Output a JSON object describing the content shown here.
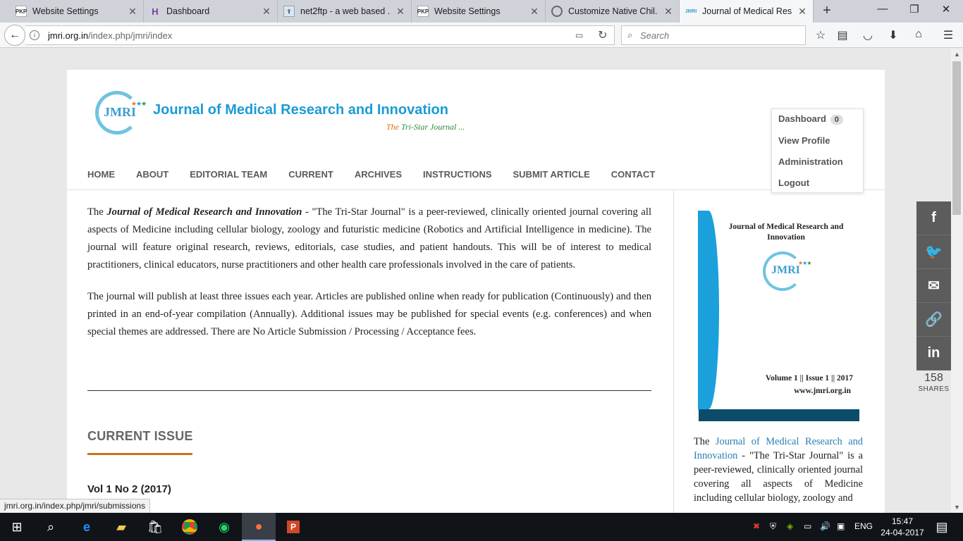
{
  "browser": {
    "tabs": [
      {
        "favicon": "PKP",
        "label": "Website Settings"
      },
      {
        "favicon": "H",
        "label": "Dashboard"
      },
      {
        "favicon": "net2ftp-icon",
        "label": "net2ftp - a web based ..."
      },
      {
        "favicon": "PKP",
        "label": "Website Settings"
      },
      {
        "favicon": "chat-icon",
        "label": "Customize Native Chil..."
      },
      {
        "favicon": "JMRI",
        "label": "Journal of Medical Res..."
      }
    ],
    "url_host": "jmri.org.in",
    "url_path": "/index.php/jmri/index",
    "search_placeholder": "Search"
  },
  "site": {
    "logo_text": "JMRI",
    "title": "Journal of Medical Research and Innovation",
    "tagline_prefix": "The",
    "tagline_main": "Tri-Star Journal ...",
    "nav": [
      "HOME",
      "ABOUT",
      "EDITORIAL TEAM",
      "CURRENT",
      "ARCHIVES",
      "INSTRUCTIONS",
      "SUBMIT ARTICLE",
      "CONTACT"
    ]
  },
  "user_menu": {
    "dashboard": "Dashboard",
    "dashboard_count": "0",
    "view_profile": "View Profile",
    "administration": "Administration",
    "logout": "Logout"
  },
  "content": {
    "p1_intro": "The",
    "p1_journal": "Journal of Medical Research and Innovation",
    "p1_rest": " - \"The Tri-Star Journal\" is a peer-reviewed, clinically oriented journal covering all aspects of Medicine including cellular biology, zoology and futuristic medicine (Robotics and Artificial Intelligence in medicine). The journal will feature original research, reviews, editorials, case studies, and patient handouts. This will be of interest to medical practitioners, clinical educators, nurse practitioners and other health care professionals involved in the care of patients.",
    "p2": "The journal will publish at least three issues each year. Articles are published online when ready for publication (Continuously) and then printed in an end-of-year compilation (Annually). Additional issues may be published for special events (e.g. conferences) and when special themes are addressed. There are No Article Submission / Processing / Acceptance fees.",
    "current_issue_heading": "CURRENT ISSUE",
    "issue_title": "Vol 1 No 2 (2017)"
  },
  "sidebar": {
    "cover_title": "Journal of Medical Research and Innovation",
    "cover_logo": "JMRI",
    "cover_volume": "Volume 1  ||  Issue 1  ||  2017",
    "cover_website": "www.jmri.org.in",
    "text_intro": "The",
    "text_link": "Journal of Medical Research and Innovation",
    "text_rest": " - \"The Tri-Star Journal\" is a peer-reviewed, clinically oriented journal covering all aspects of Medicine including cellular biology, zoology and"
  },
  "share": {
    "count": "158",
    "label": "SHARES"
  },
  "status_link": "jmri.org.in/index.php/jmri/submissions",
  "taskbar": {
    "language": "ENG",
    "time": "15:47",
    "date": "24-04-2017"
  }
}
